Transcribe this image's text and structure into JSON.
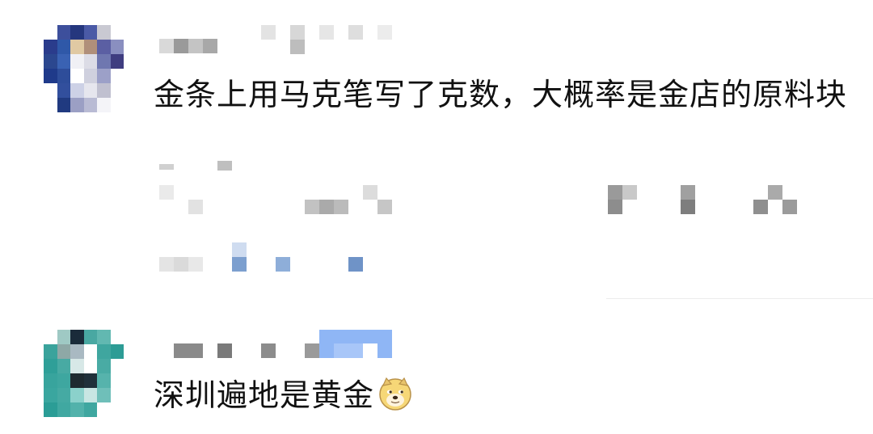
{
  "comments": [
    {
      "text": "金条上用马克笔写了克数，大概率是金店的原料块"
    },
    {
      "text": "深圳遍地是黄金",
      "emoji": "doge-emoji"
    }
  ],
  "colors": {
    "text": "#111111",
    "divider": "#ececec",
    "mosaic_gray": "#bdbdbd",
    "mosaic_blue": "#7c9fcf"
  }
}
